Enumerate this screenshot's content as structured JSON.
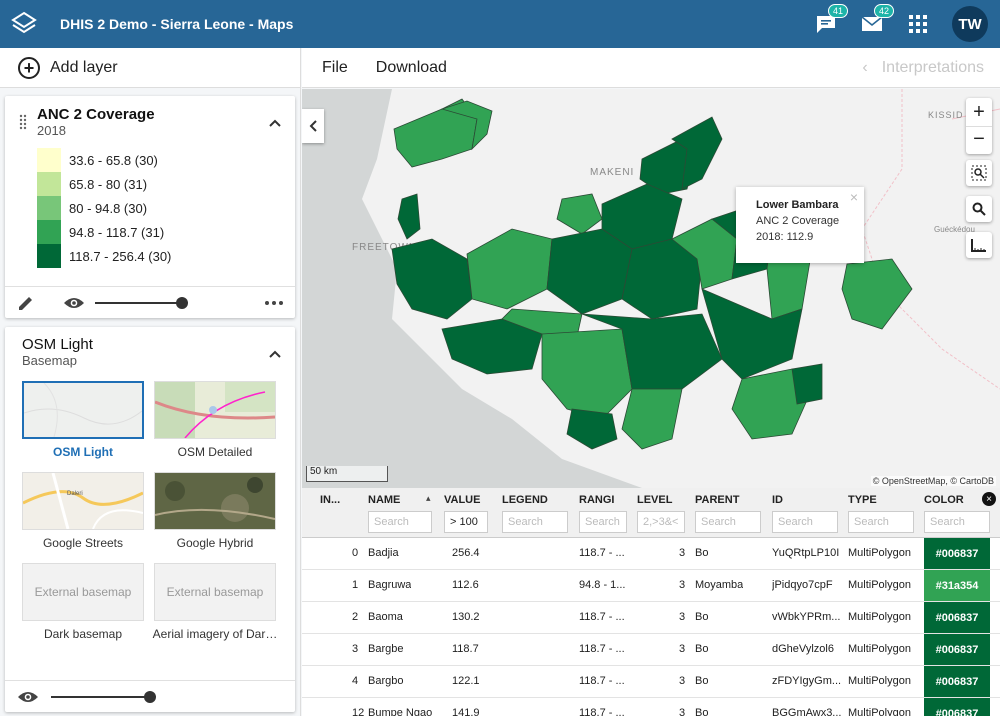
{
  "header": {
    "title": "DHIS 2 Demo - Sierra Leone - Maps",
    "messages_badge": "41",
    "inbox_badge": "42",
    "user_initials": "TW"
  },
  "sidebar": {
    "add_layer_label": "Add layer"
  },
  "thematic_layer": {
    "title": "ANC 2 Coverage",
    "period": "2018",
    "legend": [
      {
        "label": "33.6 - 65.8 (30)",
        "color": "#ffffcc"
      },
      {
        "label": "65.8 - 80 (31)",
        "color": "#c2e699"
      },
      {
        "label": "80 - 94.8 (30)",
        "color": "#78c679"
      },
      {
        "label": "94.8 - 118.7 (31)",
        "color": "#31a354"
      },
      {
        "label": "118.7 - 256.4 (30)",
        "color": "#006837"
      }
    ]
  },
  "basemap_layer": {
    "title": "OSM Light",
    "subtitle": "Basemap",
    "options": [
      {
        "label": "OSM Light"
      },
      {
        "label": "OSM Detailed"
      },
      {
        "label": "Google Streets"
      },
      {
        "label": "Google Hybrid"
      },
      {
        "label": "Dark basemap",
        "placeholder": "External basemap"
      },
      {
        "label": "Aerial imagery of Dar…",
        "placeholder": "External basemap"
      }
    ]
  },
  "menu": {
    "file": "File",
    "download": "Download",
    "interpretations": "Interpretations"
  },
  "map": {
    "labels": {
      "makeni": "MAKENI",
      "freetown": "FREETOWN",
      "kissid": "KISSID",
      "gueckedou": "Guéckédou"
    },
    "popup": {
      "name": "Lower Bambara",
      "layer": "ANC 2 Coverage",
      "value": "2018: 112.9"
    },
    "scale": "50 km",
    "attribution": "© OpenStreetMap, © CartoDB"
  },
  "table": {
    "columns": [
      "IN...",
      "NAME",
      "VALUE",
      "LEGEND",
      "RANGI",
      "LEVEL",
      "PARENT",
      "ID",
      "TYPE",
      "COLOR"
    ],
    "filters": [
      "",
      "Search",
      "> 100",
      "Search",
      "Search",
      "2,>3&<",
      "Search",
      "Search",
      "Search",
      "Search"
    ],
    "rows": [
      {
        "index": "0",
        "name": "Badjia",
        "value": "256.4",
        "legend": "",
        "range": "118.7 - ...",
        "level": "3",
        "parent": "Bo",
        "id": "YuQRtpLP10I",
        "type": "MultiPolygon",
        "color": "#006837"
      },
      {
        "index": "1",
        "name": "Bagruwa",
        "value": "112.6",
        "legend": "",
        "range": "94.8 - 1...",
        "level": "3",
        "parent": "Moyamba",
        "id": "jPidqyo7cpF",
        "type": "MultiPolygon",
        "color": "#31a354"
      },
      {
        "index": "2",
        "name": "Baoma",
        "value": "130.2",
        "legend": "",
        "range": "118.7 - ...",
        "level": "3",
        "parent": "Bo",
        "id": "vWbkYPRm...",
        "type": "MultiPolygon",
        "color": "#006837"
      },
      {
        "index": "3",
        "name": "Bargbe",
        "value": "118.7",
        "legend": "",
        "range": "118.7 - ...",
        "level": "3",
        "parent": "Bo",
        "id": "dGheVylzol6",
        "type": "MultiPolygon",
        "color": "#006837"
      },
      {
        "index": "4",
        "name": "Bargbo",
        "value": "122.1",
        "legend": "",
        "range": "118.7 - ...",
        "level": "3",
        "parent": "Bo",
        "id": "zFDYIgyGm...",
        "type": "MultiPolygon",
        "color": "#006837"
      },
      {
        "index": "12",
        "name": "Bumpe Ngao",
        "value": "141.9",
        "legend": "",
        "range": "118.7 - ...",
        "level": "3",
        "parent": "Bo",
        "id": "BGGmAwx3...",
        "type": "MultiPolygon",
        "color": "#006837"
      }
    ]
  }
}
